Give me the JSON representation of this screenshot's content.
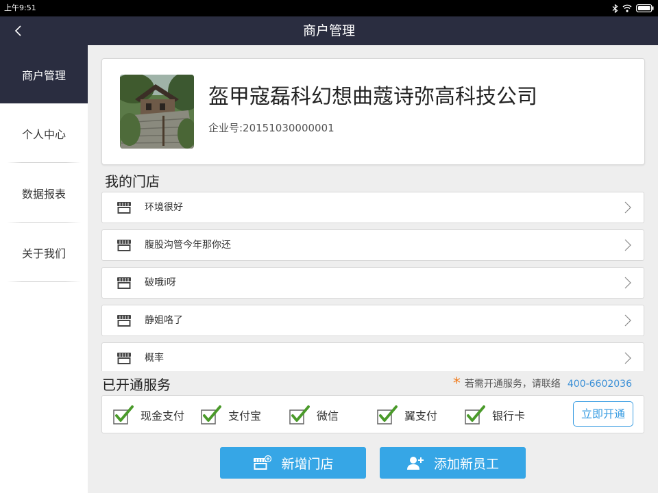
{
  "status_bar": {
    "time": "上午9:51"
  },
  "navbar": {
    "title": "商户管理"
  },
  "sidebar": {
    "items": [
      {
        "label": "商户管理"
      },
      {
        "label": "个人中心"
      },
      {
        "label": "数据报表"
      },
      {
        "label": "关于我们"
      }
    ]
  },
  "company": {
    "name": "盔甲寇磊科幻想曲蔻诗弥高科技公司",
    "id_text": "企业号:20151030000001"
  },
  "stores": {
    "title": "我的门店",
    "items": [
      {
        "label": "环境很好"
      },
      {
        "label": "腹股沟管今年那你还"
      },
      {
        "label": "破哦i呀"
      },
      {
        "label": "静姐咯了"
      },
      {
        "label": "概率"
      }
    ]
  },
  "services": {
    "title": "已开通服务",
    "note": "若需开通服务，请联络",
    "phone": "400-6602036",
    "items": [
      {
        "label": "现金支付",
        "checked": true
      },
      {
        "label": "支付宝",
        "checked": true
      },
      {
        "label": "微信",
        "checked": true
      },
      {
        "label": "翼支付",
        "checked": true
      },
      {
        "label": "银行卡",
        "checked": true
      }
    ],
    "open_label": "立即开通"
  },
  "actions": {
    "add_store": "新增门店",
    "add_staff": "添加新员工"
  },
  "colors": {
    "nav_bg": "#2a2d40",
    "accent_blue": "#36a6e6",
    "check_green": "#4a9a2a",
    "note_star": "#f07a1b"
  }
}
